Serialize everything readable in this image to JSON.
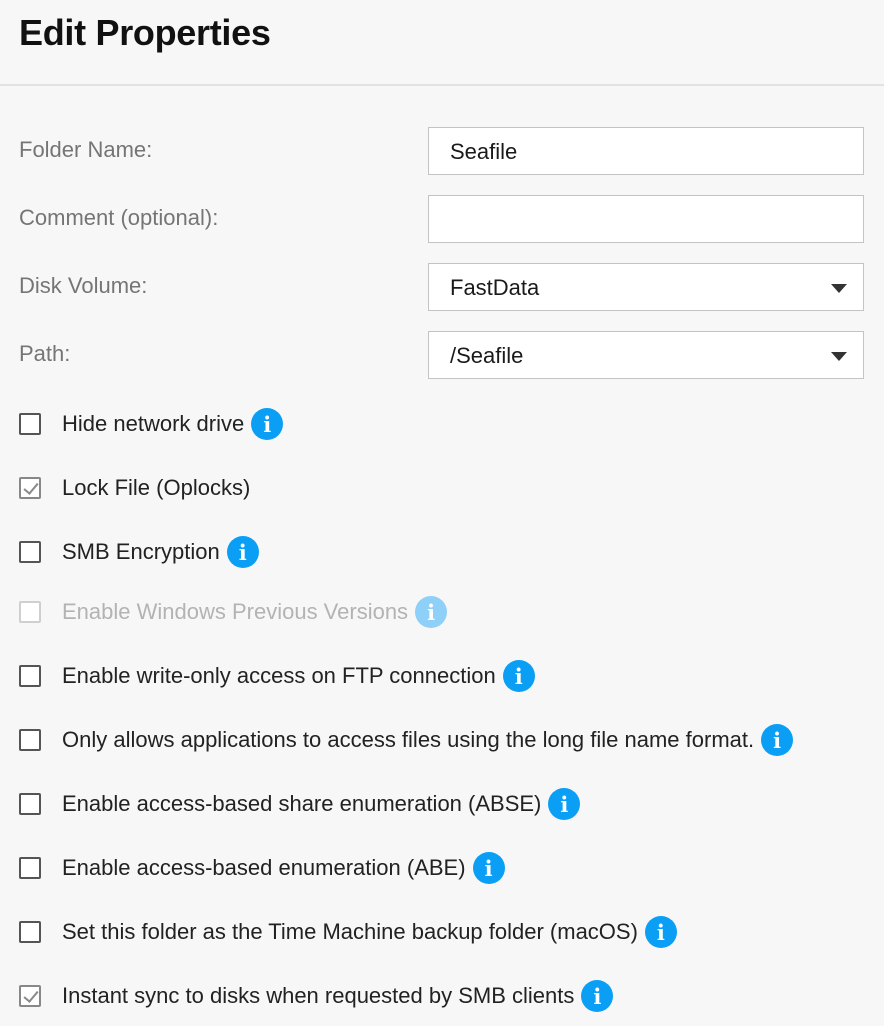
{
  "page": {
    "title": "Edit Properties"
  },
  "form": {
    "folder_name": {
      "label": "Folder Name:",
      "value": "Seafile"
    },
    "comment": {
      "label": "Comment (optional):",
      "value": ""
    },
    "disk_volume": {
      "label": "Disk Volume:",
      "value": "FastData"
    },
    "path": {
      "label": "Path:",
      "value": "/Seafile"
    }
  },
  "options": [
    {
      "label": "Hide network drive",
      "checked": false,
      "disabled": false,
      "info_icon": true
    },
    {
      "label": "Lock File (Oplocks)",
      "checked": true,
      "disabled": false,
      "info_icon": false
    },
    {
      "label": "SMB Encryption",
      "checked": false,
      "disabled": false,
      "info_icon": true
    },
    {
      "label": "Enable Windows Previous Versions",
      "checked": false,
      "disabled": true,
      "info_icon": true
    },
    {
      "label": "Enable write-only access on FTP connection",
      "checked": false,
      "disabled": false,
      "info_icon": true
    },
    {
      "label": "Only allows applications to access files using the long file name format.",
      "checked": false,
      "disabled": false,
      "info_icon": true
    },
    {
      "label": "Enable access-based share enumeration (ABSE)",
      "checked": false,
      "disabled": false,
      "info_icon": true
    },
    {
      "label": "Enable access-based enumeration (ABE)",
      "checked": false,
      "disabled": false,
      "info_icon": true
    },
    {
      "label": "Set this folder as the Time Machine backup folder (macOS)",
      "checked": false,
      "disabled": false,
      "info_icon": true
    },
    {
      "label": "Instant sync to disks when requested by SMB clients",
      "checked": true,
      "disabled": false,
      "info_icon": true
    }
  ],
  "icons": {
    "info_glyph": "i",
    "info_color": "#0a9ff5",
    "info_disabled_color": "#8fd0f8"
  }
}
